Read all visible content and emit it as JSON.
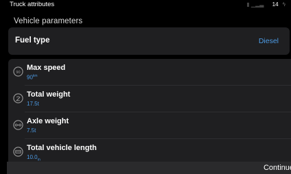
{
  "status_bar": {
    "title": "Truck attributes",
    "clock": "14"
  },
  "section": {
    "title": "Vehicle parameters"
  },
  "fuel": {
    "label": "Fuel type",
    "value": "Diesel"
  },
  "rows": [
    {
      "label": "Max speed",
      "value": "90",
      "unit": "km",
      "icon": "speed-limit-icon"
    },
    {
      "label": "Total weight",
      "value": "17.5t",
      "icon": "weight-icon"
    },
    {
      "label": "Axle weight",
      "value": "7.5t",
      "icon": "axle-icon"
    },
    {
      "label": "Total vehicle length",
      "value": "10.0",
      "unit": "m",
      "icon": "length-icon"
    }
  ],
  "footer": {
    "continue_label": "Continue"
  },
  "colors": {
    "accent": "#4d9ce6",
    "card": "#1f1f21",
    "background": "#000000"
  }
}
